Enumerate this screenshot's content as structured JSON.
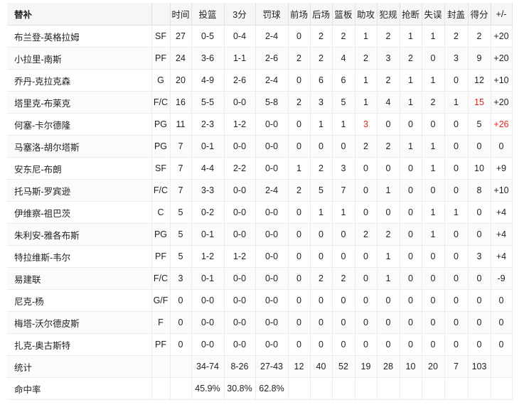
{
  "table": {
    "headers": {
      "name": "替补",
      "pos": "",
      "min": "时间",
      "fg": "投篮",
      "three": "3分",
      "ft": "罚球",
      "oreb": "前场",
      "dreb": "后场",
      "reb": "篮板",
      "ast": "助攻",
      "pf": "犯规",
      "stl": "抢断",
      "tov": "失误",
      "blk": "封盖",
      "pts": "得分",
      "pm": "+/-"
    },
    "highlight_color": "#e8201c",
    "rows": [
      {
        "name": "布兰登-英格拉姆",
        "pos": "SF",
        "min": "27",
        "fg": "0-5",
        "three": "0-4",
        "ft": "2-4",
        "oreb": "0",
        "dreb": "2",
        "reb": "2",
        "ast": "1",
        "pf": "2",
        "stl": "1",
        "tov": "1",
        "blk": "2",
        "pts": "2",
        "pm": "+20"
      },
      {
        "name": "小拉里-南斯",
        "pos": "PF",
        "min": "24",
        "fg": "3-6",
        "three": "1-1",
        "ft": "2-6",
        "oreb": "2",
        "dreb": "2",
        "reb": "4",
        "ast": "2",
        "pf": "3",
        "stl": "2",
        "tov": "0",
        "blk": "3",
        "pts": "9",
        "pm": "+20"
      },
      {
        "name": "乔丹-克拉克森",
        "pos": "G",
        "min": "20",
        "fg": "4-9",
        "three": "2-6",
        "ft": "2-4",
        "oreb": "0",
        "dreb": "6",
        "reb": "6",
        "ast": "1",
        "pf": "2",
        "stl": "1",
        "tov": "1",
        "blk": "0",
        "pts": "12",
        "pm": "+10"
      },
      {
        "name": "塔里克-布莱克",
        "pos": "F/C",
        "min": "16",
        "fg": "5-5",
        "three": "0-0",
        "ft": "5-8",
        "oreb": "2",
        "dreb": "3",
        "reb": "5",
        "ast": "1",
        "pf": "4",
        "stl": "1",
        "tov": "2",
        "blk": "1",
        "pts": "15",
        "pm": "+20",
        "pts_red": true
      },
      {
        "name": "何塞-卡尔德隆",
        "pos": "PG",
        "min": "11",
        "fg": "2-3",
        "three": "1-2",
        "ft": "0-0",
        "oreb": "0",
        "dreb": "1",
        "reb": "1",
        "ast": "3",
        "pf": "0",
        "stl": "0",
        "tov": "0",
        "blk": "0",
        "pts": "5",
        "pm": "+26",
        "ast_red": true,
        "pm_red": true
      },
      {
        "name": "马塞洛-胡尔塔斯",
        "pos": "PG",
        "min": "7",
        "fg": "0-1",
        "three": "0-0",
        "ft": "0-0",
        "oreb": "0",
        "dreb": "0",
        "reb": "0",
        "ast": "2",
        "pf": "2",
        "stl": "1",
        "tov": "1",
        "blk": "0",
        "pts": "0",
        "pm": "0"
      },
      {
        "name": "安东尼-布朗",
        "pos": "SF",
        "min": "7",
        "fg": "4-4",
        "three": "2-2",
        "ft": "0-0",
        "oreb": "1",
        "dreb": "2",
        "reb": "3",
        "ast": "0",
        "pf": "0",
        "stl": "0",
        "tov": "1",
        "blk": "0",
        "pts": "10",
        "pm": "+9"
      },
      {
        "name": "托马斯-罗宾逊",
        "pos": "F/C",
        "min": "7",
        "fg": "3-3",
        "three": "0-0",
        "ft": "2-4",
        "oreb": "2",
        "dreb": "5",
        "reb": "7",
        "ast": "0",
        "pf": "1",
        "stl": "0",
        "tov": "0",
        "blk": "0",
        "pts": "8",
        "pm": "+10"
      },
      {
        "name": "伊维察-祖巴茨",
        "pos": "C",
        "min": "5",
        "fg": "0-2",
        "three": "0-0",
        "ft": "0-0",
        "oreb": "0",
        "dreb": "1",
        "reb": "1",
        "ast": "0",
        "pf": "0",
        "stl": "0",
        "tov": "1",
        "blk": "1",
        "pts": "0",
        "pm": "+4"
      },
      {
        "name": "朱利安-雅各布斯",
        "pos": "PG",
        "min": "5",
        "fg": "0-1",
        "three": "0-0",
        "ft": "0-0",
        "oreb": "0",
        "dreb": "0",
        "reb": "0",
        "ast": "2",
        "pf": "2",
        "stl": "0",
        "tov": "1",
        "blk": "0",
        "pts": "0",
        "pm": "+4"
      },
      {
        "name": "特拉维斯-韦尔",
        "pos": "PF",
        "min": "5",
        "fg": "1-2",
        "three": "1-2",
        "ft": "0-0",
        "oreb": "0",
        "dreb": "0",
        "reb": "0",
        "ast": "0",
        "pf": "1",
        "stl": "0",
        "tov": "0",
        "blk": "0",
        "pts": "3",
        "pm": "+4"
      },
      {
        "name": "易建联",
        "pos": "F/C",
        "min": "3",
        "fg": "0-1",
        "three": "0-0",
        "ft": "0-0",
        "oreb": "0",
        "dreb": "2",
        "reb": "2",
        "ast": "0",
        "pf": "1",
        "stl": "0",
        "tov": "0",
        "blk": "0",
        "pts": "0",
        "pm": "-9"
      },
      {
        "name": "尼克-杨",
        "pos": "G/F",
        "min": "0",
        "fg": "0-0",
        "three": "0-0",
        "ft": "0-0",
        "oreb": "0",
        "dreb": "0",
        "reb": "0",
        "ast": "0",
        "pf": "0",
        "stl": "0",
        "tov": "0",
        "blk": "0",
        "pts": "0",
        "pm": "0"
      },
      {
        "name": "梅塔-沃尔德皮斯",
        "pos": "F",
        "min": "0",
        "fg": "0-0",
        "three": "0-0",
        "ft": "0-0",
        "oreb": "0",
        "dreb": "0",
        "reb": "0",
        "ast": "0",
        "pf": "0",
        "stl": "0",
        "tov": "0",
        "blk": "0",
        "pts": "0",
        "pm": "0"
      },
      {
        "name": "扎克-奥古斯特",
        "pos": "PF",
        "min": "0",
        "fg": "0-0",
        "three": "0-0",
        "ft": "0-0",
        "oreb": "0",
        "dreb": "0",
        "reb": "0",
        "ast": "0",
        "pf": "0",
        "stl": "0",
        "tov": "0",
        "blk": "0",
        "pts": "0",
        "pm": "0"
      }
    ],
    "totals": {
      "label": "统计",
      "pos": "",
      "min": "",
      "fg": "34-74",
      "three": "8-26",
      "ft": "27-43",
      "oreb": "12",
      "dreb": "40",
      "reb": "52",
      "ast": "19",
      "pf": "28",
      "stl": "10",
      "tov": "20",
      "blk": "7",
      "pts": "103",
      "pm": ""
    },
    "percentages": {
      "label": "命中率",
      "fg": "45.9%",
      "three": "30.8%",
      "ft": "62.8%"
    }
  }
}
